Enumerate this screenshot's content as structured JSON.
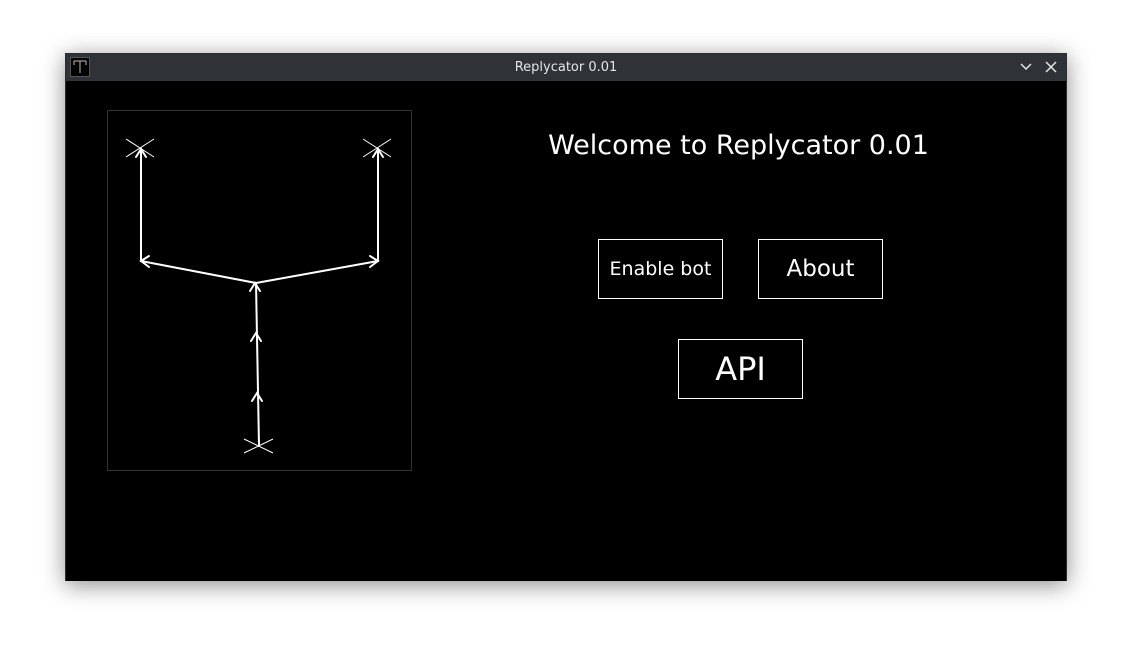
{
  "window": {
    "title": "Replycator 0.01",
    "app_icon": "app-icon",
    "controls": [
      "chevron-down-icon",
      "close-icon"
    ]
  },
  "main": {
    "welcome": "Welcome to Replycator 0.01",
    "buttons": {
      "enable_bot": "Enable bot",
      "about": "About",
      "api": "API"
    },
    "diagram_icon": "y-branch-diagram"
  },
  "colors": {
    "background": "#000000",
    "foreground": "#ffffff",
    "titlebar": "#2f3337"
  }
}
